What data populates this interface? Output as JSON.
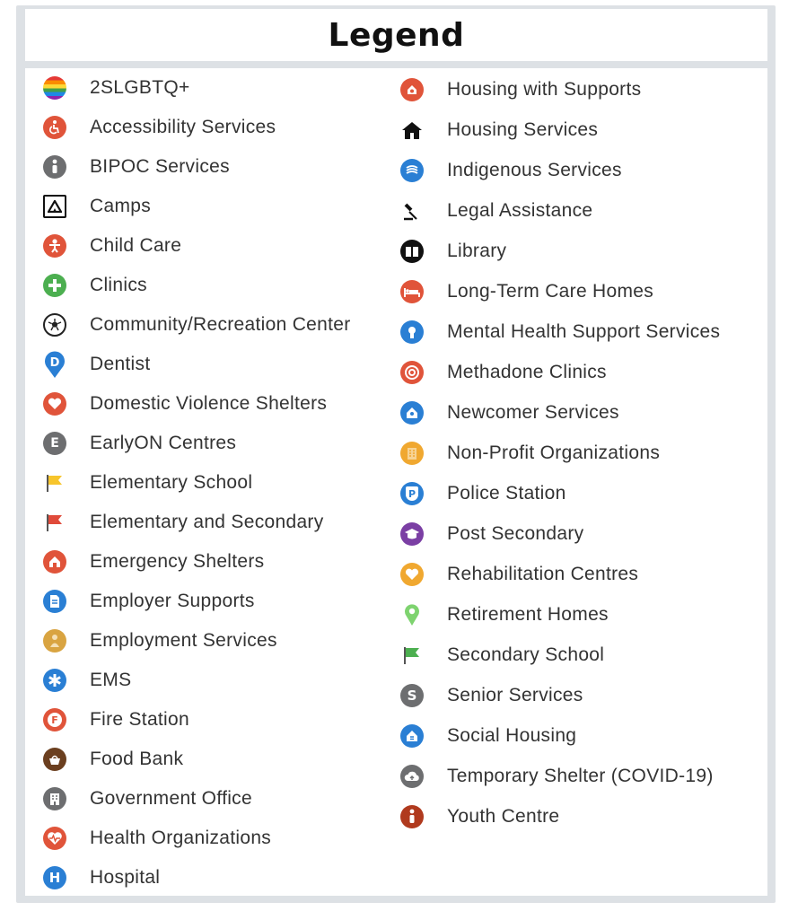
{
  "title": "Legend",
  "left_items": [
    {
      "label": "2SLGBTQ+",
      "icon": "rainbow-icon"
    },
    {
      "label": "Accessibility Services",
      "icon": "accessibility-icon"
    },
    {
      "label": "BIPOC Services",
      "icon": "info-person-icon"
    },
    {
      "label": "Camps",
      "icon": "tent-icon"
    },
    {
      "label": "Child Care",
      "icon": "child-icon"
    },
    {
      "label": "Clinics",
      "icon": "cross-icon"
    },
    {
      "label": "Community/Recreation Center",
      "icon": "soccer-ball-icon"
    },
    {
      "label": "Dentist",
      "icon": "dentist-pin-icon"
    },
    {
      "label": "Domestic Violence Shelters",
      "icon": "heart-hand-icon"
    },
    {
      "label": "EarlyON Centres",
      "icon": "letter-e-icon"
    },
    {
      "label": "Elementary School",
      "icon": "yellow-flag-icon"
    },
    {
      "label": "Elementary and Secondary",
      "icon": "red-flag-icon"
    },
    {
      "label": "Emergency Shelters",
      "icon": "shelter-icon"
    },
    {
      "label": "Employer Supports",
      "icon": "document-icon"
    },
    {
      "label": "Employment Services",
      "icon": "employment-icon"
    },
    {
      "label": "EMS",
      "icon": "star-of-life-icon"
    },
    {
      "label": "Fire Station",
      "icon": "fire-icon"
    },
    {
      "label": "Food Bank",
      "icon": "food-bank-icon"
    },
    {
      "label": "Government Office",
      "icon": "building-icon"
    },
    {
      "label": "Health Organizations",
      "icon": "heartbeat-icon"
    },
    {
      "label": "Hospital",
      "icon": "hospital-icon"
    }
  ],
  "right_items": [
    {
      "label": "Housing with Supports",
      "icon": "housing-support-icon"
    },
    {
      "label": "Housing Services",
      "icon": "house-icon"
    },
    {
      "label": "Indigenous Services",
      "icon": "indigenous-icon"
    },
    {
      "label": "Legal Assistance",
      "icon": "gavel-icon"
    },
    {
      "label": "Library",
      "icon": "book-icon"
    },
    {
      "label": "Long-Term Care Homes",
      "icon": "bed-icon"
    },
    {
      "label": "Mental Health Support Services",
      "icon": "mental-health-icon"
    },
    {
      "label": "Methadone Clinics",
      "icon": "target-icon"
    },
    {
      "label": "Newcomer Services",
      "icon": "newcomer-icon"
    },
    {
      "label": "Non-Profit Organizations",
      "icon": "nonprofit-icon"
    },
    {
      "label": "Police Station",
      "icon": "police-icon"
    },
    {
      "label": "Post Secondary",
      "icon": "graduation-cap-icon"
    },
    {
      "label": "Rehabilitation Centres",
      "icon": "rehab-heart-icon"
    },
    {
      "label": "Retirement Homes",
      "icon": "location-pin-icon"
    },
    {
      "label": "Secondary School",
      "icon": "green-flag-icon"
    },
    {
      "label": "Senior Services",
      "icon": "letter-s-icon"
    },
    {
      "label": "Social Housing",
      "icon": "social-housing-icon"
    },
    {
      "label": "Temporary Shelter (COVID-19)",
      "icon": "cloud-shelter-icon"
    },
    {
      "label": "Youth Centre",
      "icon": "youth-icon"
    }
  ],
  "colors": {
    "frame": "#dde1e5",
    "text": "#333333"
  }
}
